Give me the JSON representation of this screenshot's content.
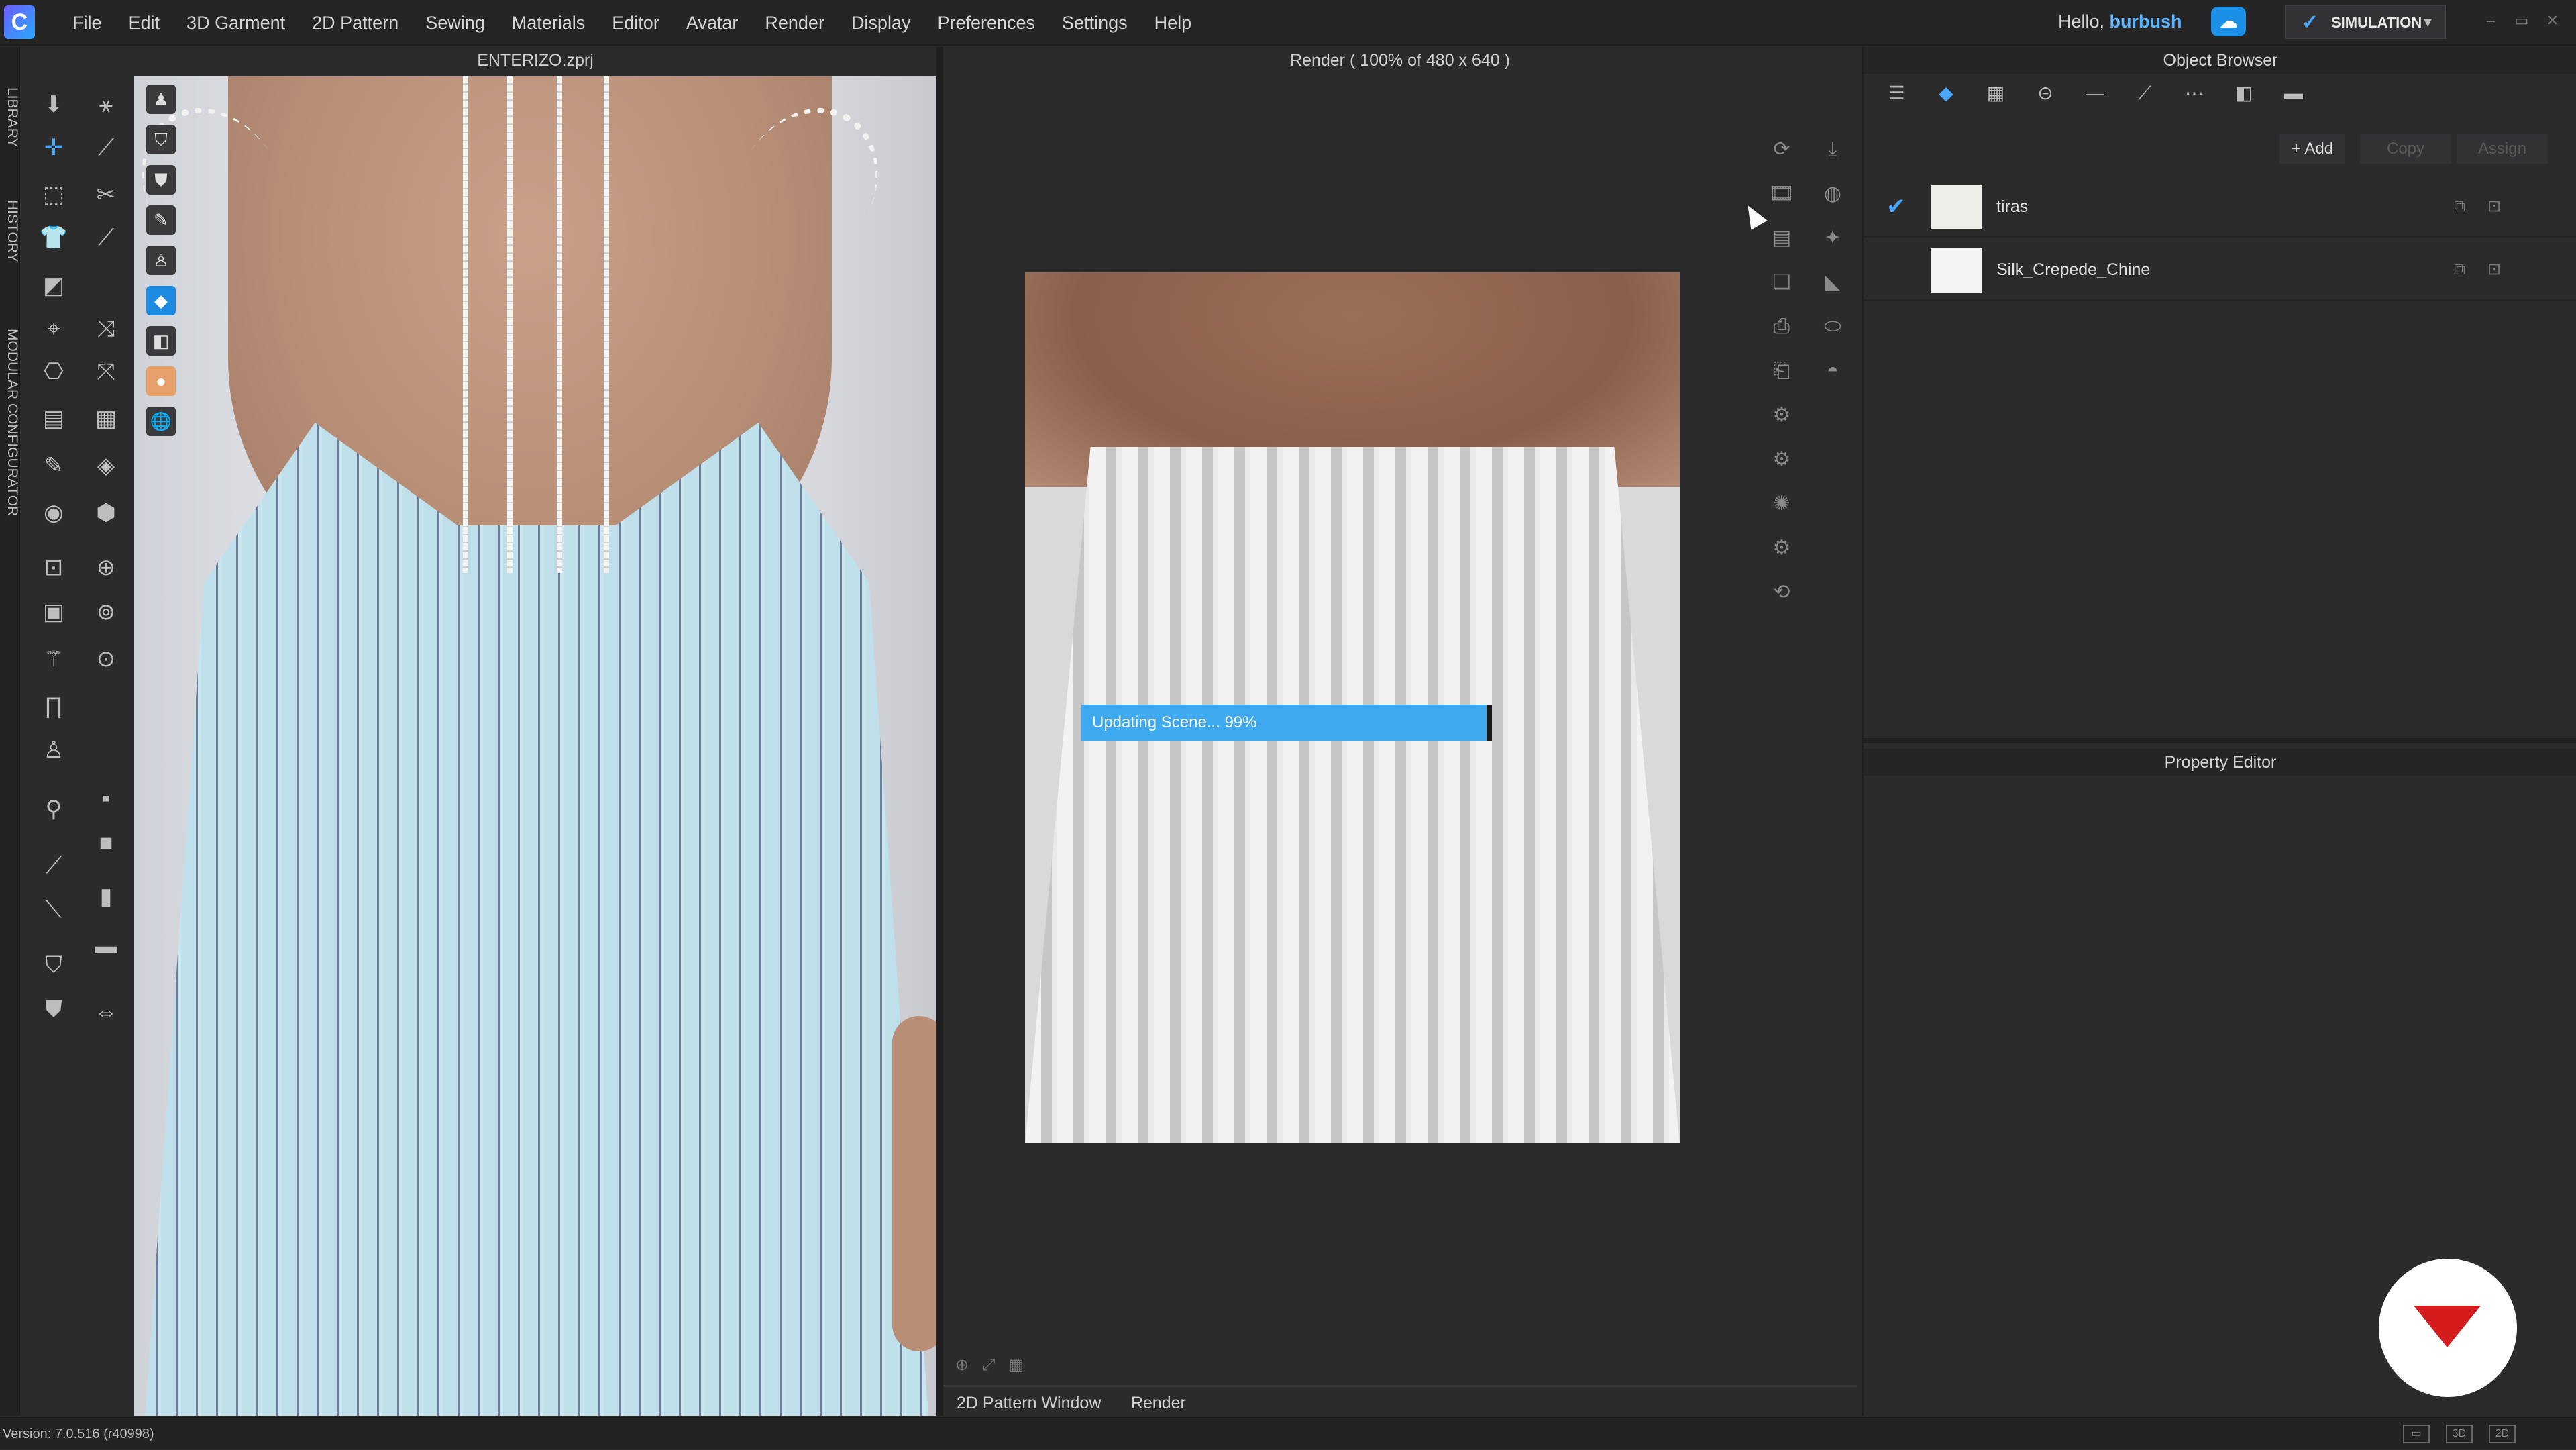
{
  "app": {
    "logo": "C"
  },
  "menu": [
    "File",
    "Edit",
    "3D Garment",
    "2D Pattern",
    "Sewing",
    "Materials",
    "Editor",
    "Avatar",
    "Render",
    "Display",
    "Preferences",
    "Settings",
    "Help"
  ],
  "user": {
    "greeting": "Hello,",
    "name": "burbush"
  },
  "mode": {
    "label": "SIMULATION"
  },
  "left_tabs": [
    "LIBRARY",
    "HISTORY",
    "MODULAR CONFIGURATOR"
  ],
  "viewport3d": {
    "title": "ENTERIZO.zprj"
  },
  "render": {
    "title": "Render ( 100% of 480 x 640 )",
    "progress": {
      "text": "Updating Scene... 99%",
      "value": 0.99
    }
  },
  "bottom_tabs": [
    "2D Pattern Window",
    "Render"
  ],
  "object_browser": {
    "title": "Object Browser",
    "buttons": {
      "add": "+ Add",
      "copy": "Copy",
      "assign": "Assign"
    },
    "items": [
      {
        "name": "tiras",
        "checked": true
      },
      {
        "name": "Silk_Crepede_Chine",
        "checked": false
      }
    ]
  },
  "property_editor": {
    "title": "Property Editor"
  },
  "status": {
    "version": "Version: 7.0.516 (r40998)",
    "views": [
      "▭",
      "3D",
      "2D"
    ]
  },
  "colors": {
    "accent": "#4aa8ff",
    "progress": "#3ea9ef",
    "brand_red": "#d41c1c"
  }
}
